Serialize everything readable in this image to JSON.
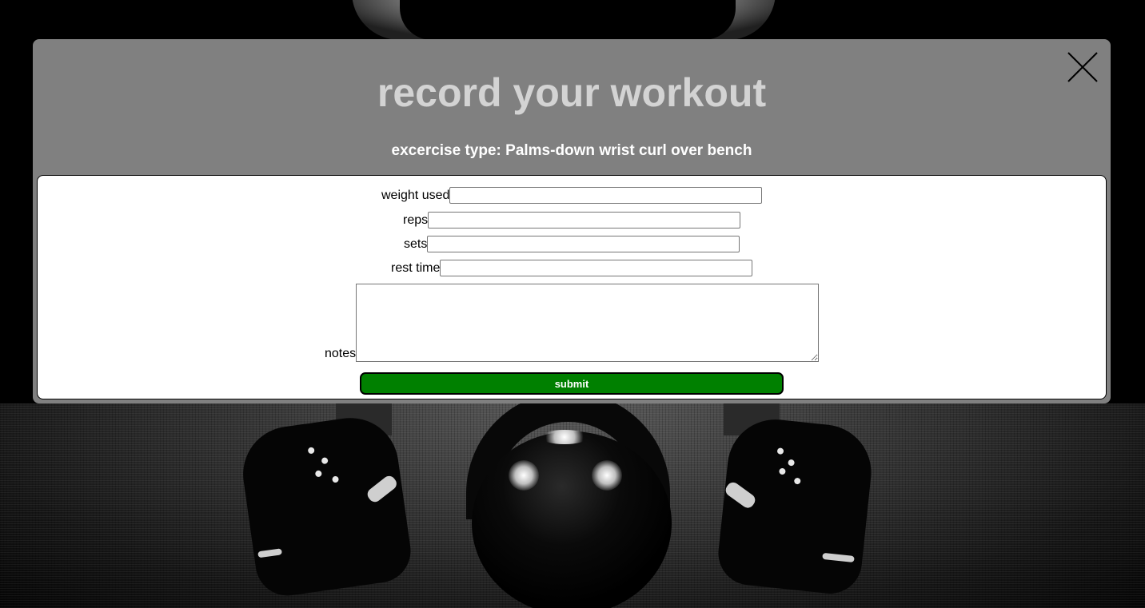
{
  "modal": {
    "title": "record your workout",
    "exercise_type": "excercise type: Palms-down wrist curl over bench",
    "close_icon": "close-icon"
  },
  "form": {
    "fields": [
      {
        "label": "weight used",
        "value": ""
      },
      {
        "label": "reps",
        "value": ""
      },
      {
        "label": "sets",
        "value": ""
      },
      {
        "label": "rest time",
        "value": ""
      }
    ],
    "notes": {
      "label": "notes",
      "value": ""
    },
    "submit_label": "submit"
  },
  "colors": {
    "modal_background": "#808080",
    "title_text": "#d3d3d3",
    "submit_button": "#008000",
    "page_background": "#000000"
  }
}
